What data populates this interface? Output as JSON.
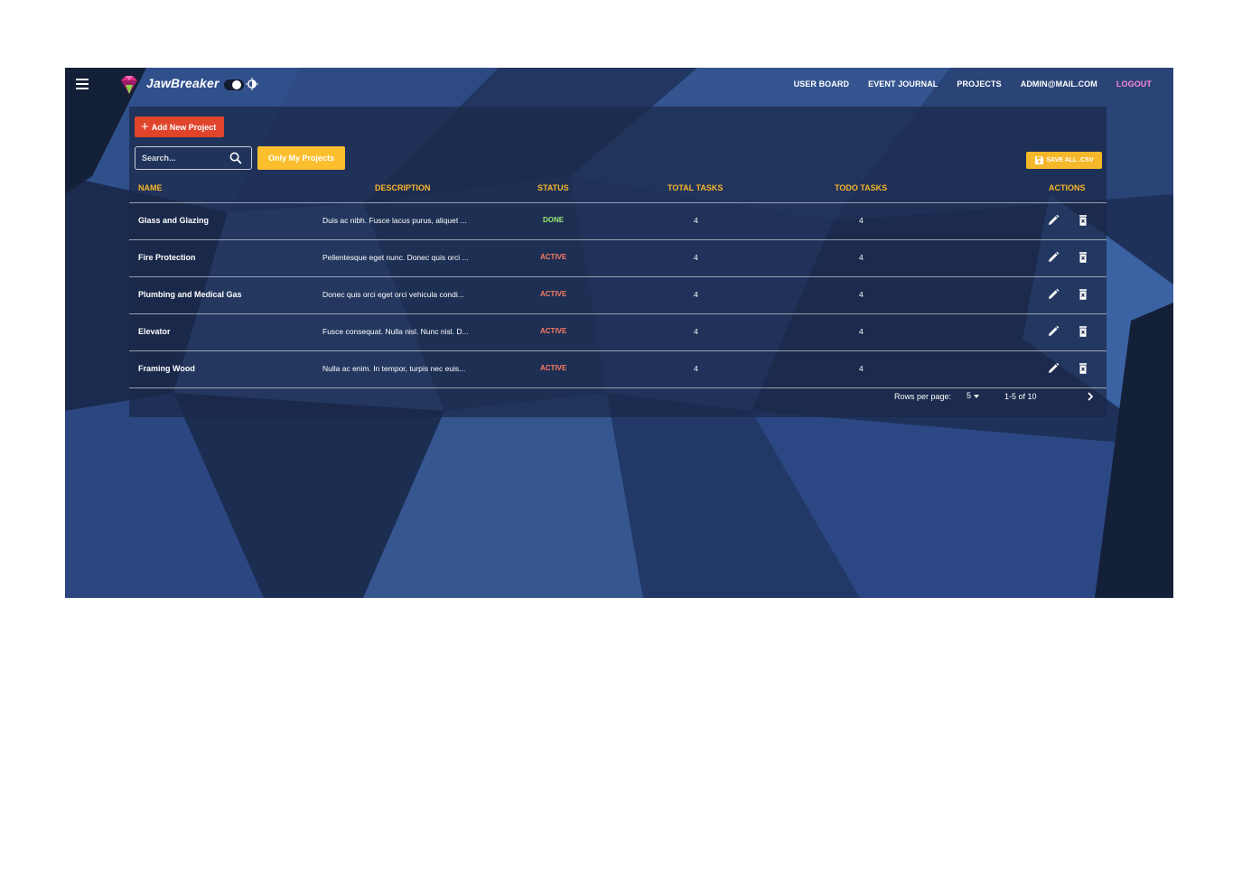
{
  "app": {
    "brand": "JawBreaker"
  },
  "nav": {
    "user_board": "USER BOARD",
    "event_journal": "EVENT JOURNAL",
    "projects": "PROJECTS",
    "user_email": "ADMIN@MAIL.COM",
    "logout": "LOGOUT"
  },
  "toolbar": {
    "add_project": "Add New Project",
    "search_placeholder": "Search...",
    "only_my_projects": "Only My Projects",
    "save_csv": "SAVE ALL .CSV"
  },
  "table": {
    "headers": {
      "name": "NAME",
      "description": "DESCRIPTION",
      "status": "STATUS",
      "total_tasks": "TOTAL TASKS",
      "todo_tasks": "TODO TASKS",
      "actions": "ACTIONS"
    },
    "rows": [
      {
        "name": "Glass and Glazing",
        "description": "Duis ac nibh. Fusce lacus purus, aliquet ...",
        "status": "DONE",
        "total": "4",
        "todo": "4"
      },
      {
        "name": "Fire Protection",
        "description": "Pellentesque eget nunc. Donec quis orci ...",
        "status": "ACTIVE",
        "total": "4",
        "todo": "4"
      },
      {
        "name": "Plumbing and Medical Gas",
        "description": "Donec quis orci eget orci vehicula condi...",
        "status": "ACTIVE",
        "total": "4",
        "todo": "4"
      },
      {
        "name": "Elevator",
        "description": "Fusce consequat. Nulla nisl. Nunc nisl. D...",
        "status": "ACTIVE",
        "total": "4",
        "todo": "4"
      },
      {
        "name": "Framing Wood",
        "description": "Nulla ac enim. In tempor, turpis nec euis...",
        "status": "ACTIVE",
        "total": "4",
        "todo": "4"
      }
    ]
  },
  "pagination": {
    "rows_per_page_label": "Rows per page:",
    "rows_per_page": "5",
    "range": "1-5 of 10"
  },
  "colors": {
    "accent": "#f7b52a",
    "add_button": "#e0452c",
    "status_done": "#9be870",
    "status_active": "#ff7a62",
    "logout": "#ff8ad8"
  },
  "icons": {
    "menu": "hamburger-menu-icon",
    "logo": "gem-logo-icon",
    "theme": "brightness-icon",
    "search": "search-icon",
    "add": "plus-icon",
    "save": "floppy-disk-icon",
    "edit": "pencil-icon",
    "delete": "trash-icon",
    "next": "chevron-right-icon"
  }
}
